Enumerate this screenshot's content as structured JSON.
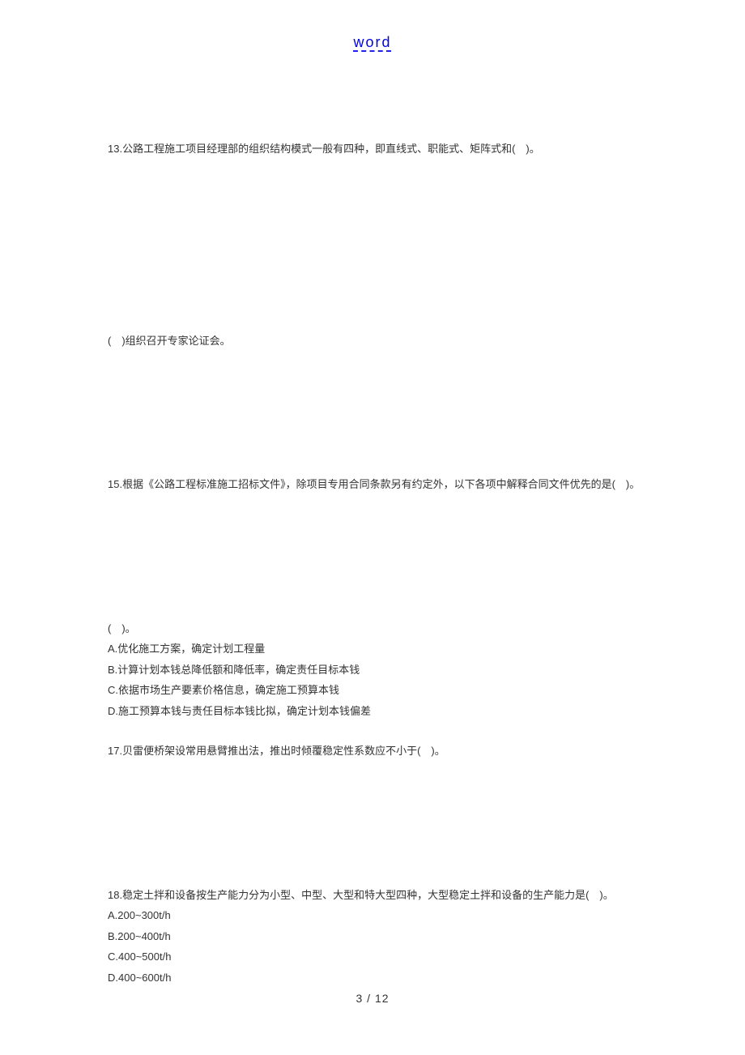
{
  "header": {
    "link": "word"
  },
  "questions": {
    "q13": "13.公路工程施工项目经理部的组织结构模式一般有四种，即直线式、职能式、矩阵式和(　)。",
    "q14_fragment": "(　)组织召开专家论证会。",
    "q15": "15.根据《公路工程标准施工招标文件》，除项目专用合同条款另有约定外，以下各项中解释合同文件优先的是(　)。",
    "q16_fragment": "(　)。",
    "q16_options": {
      "A": "A.优化施工方案，确定计划工程量",
      "B": "B.计算计划本钱总降低额和降低率，确定责任目标本钱",
      "C": "C.依据市场生产要素价格信息，确定施工预算本钱",
      "D": "D.施工预算本钱与责任目标本钱比拟，确定计划本钱偏差"
    },
    "q17": "17.贝雷便桥架设常用悬臂推出法，推出时倾覆稳定性系数应不小于(　)。",
    "q18": "18.稳定土拌和设备按生产能力分为小型、中型、大型和特大型四种，大型稳定土拌和设备的生产能力是(　)。",
    "q18_options": {
      "A": "A.200~300t/h",
      "B": "B.200~400t/h",
      "C": "C.400~500t/h",
      "D": "D.400~600t/h"
    }
  },
  "footer": {
    "page": "3 / 12"
  }
}
